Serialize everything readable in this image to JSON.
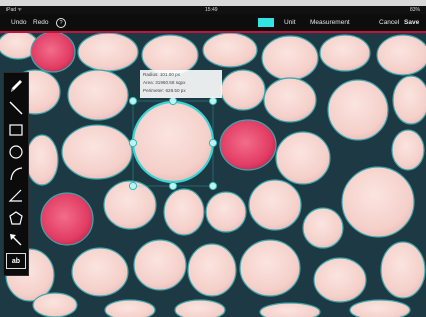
{
  "status_bar": {
    "carrier": "iPad ᯤ",
    "time": "15:49",
    "battery": "83%"
  },
  "toolbar": {
    "undo_label": "Undo",
    "redo_label": "Redo",
    "help_label": "?",
    "unit_label": "Unit",
    "measurement_label": "Measurement",
    "cancel_label": "Cancel",
    "save_label": "Save",
    "accent_color": "#33e3e3"
  },
  "measurement": {
    "radius": "Radius: 101.00 px",
    "area": "Area: 31960.58 sqpx",
    "perimeter": "Perimeter: 628.50 px"
  },
  "tools": [
    {
      "name": "pencil-icon"
    },
    {
      "name": "line-icon"
    },
    {
      "name": "rectangle-icon"
    },
    {
      "name": "circle-icon"
    },
    {
      "name": "arc-icon"
    },
    {
      "name": "angle-icon"
    },
    {
      "name": "polygon-icon"
    },
    {
      "name": "arrow-icon"
    },
    {
      "label": "ab"
    }
  ],
  "colors": {
    "cell_fill": "#f6d2cd",
    "cell_edge": "#1f3f4a",
    "stained_cell": "#e03c63",
    "handle": "#39d4d6",
    "toolbar_bg": "#0d0d0d"
  }
}
